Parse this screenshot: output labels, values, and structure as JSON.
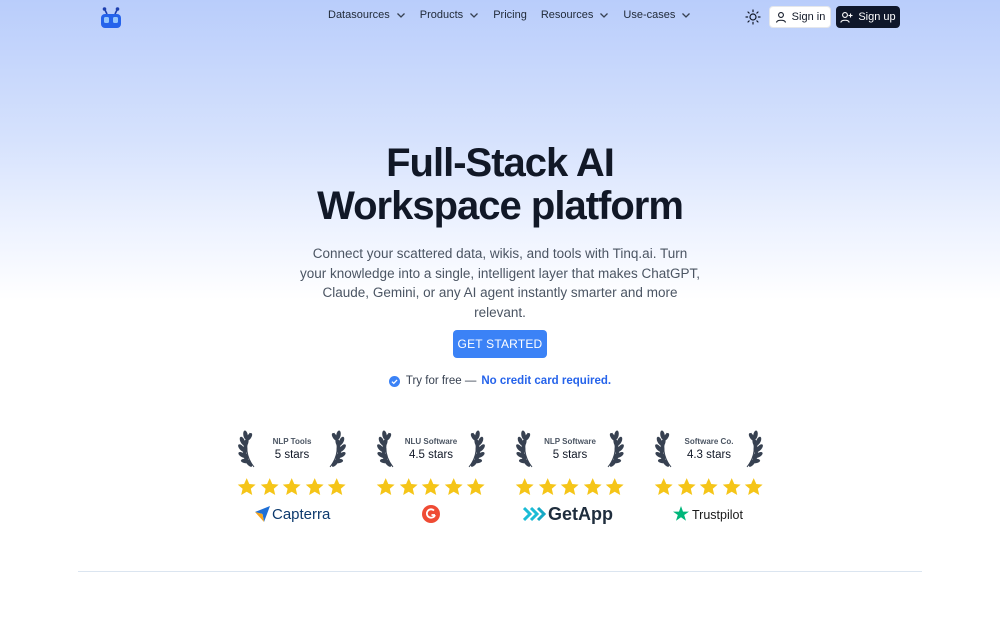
{
  "nav": {
    "items": [
      {
        "label": "Datasources",
        "has_dropdown": true
      },
      {
        "label": "Products",
        "has_dropdown": true
      },
      {
        "label": "Pricing",
        "has_dropdown": false
      },
      {
        "label": "Resources",
        "has_dropdown": true
      },
      {
        "label": "Use-cases",
        "has_dropdown": true
      }
    ],
    "theme_icon": "sun-icon",
    "sign_in": "Sign in",
    "sign_up": "Sign up"
  },
  "hero": {
    "title_line1": "Full-Stack AI",
    "title_line2": "Workspace platform",
    "subtitle": "Connect your scattered data, wikis, and tools with Tinq.ai. Turn your knowledge into a single, intelligent layer that makes ChatGPT, Claude, Gemini, or any AI agent instantly smarter and more relevant.",
    "cta": "GET STARTED",
    "try_text": "Try for free —",
    "try_emphasis": "No credit card required."
  },
  "awards": [
    {
      "category": "NLP Tools",
      "rating": "5 stars",
      "stars": 5,
      "brand": "Capterra"
    },
    {
      "category": "NLU Software",
      "rating": "4.5 stars",
      "stars": 5,
      "brand": "G2"
    },
    {
      "category": "NLP Software",
      "rating": "5 stars",
      "stars": 5,
      "brand": "GetApp"
    },
    {
      "category": "Software Co.",
      "rating": "4.3 stars",
      "stars": 5,
      "brand": "Trustpilot"
    }
  ],
  "colors": {
    "accent": "#3b82f6",
    "star": "#f5c518",
    "dark_button": "#0f172a"
  }
}
